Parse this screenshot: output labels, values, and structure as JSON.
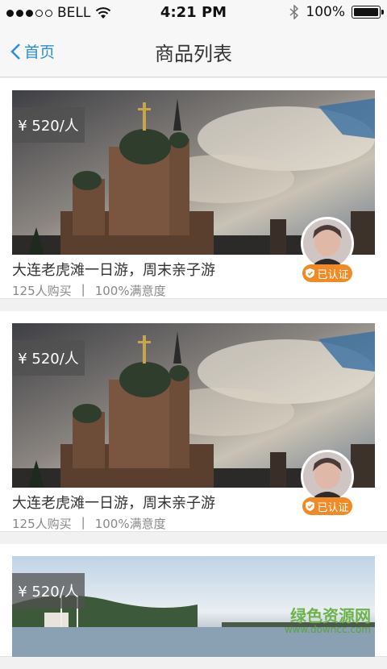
{
  "statusbar": {
    "carrier": "BELL",
    "time": "4:21 PM",
    "battery": "100%",
    "battery_level": 1.0
  },
  "nav": {
    "back_label": "首页",
    "title": "商品列表"
  },
  "products": [
    {
      "price": "¥ 520/人",
      "title": "大连老虎滩一日游，周末亲子游",
      "buyers": "125人购买",
      "satisfaction": "100%满意度",
      "badge": "已认证"
    },
    {
      "price": "¥ 520/人",
      "title": "大连老虎滩一日游，周末亲子游",
      "buyers": "125人购买",
      "satisfaction": "100%满意度",
      "badge": "已认证"
    },
    {
      "price": "¥ 520/人"
    }
  ],
  "watermark": {
    "text": "绿色资源网",
    "url": "www.downcc.com"
  },
  "colors": {
    "accent": "#2a8fd6",
    "badge": "#f08a24"
  }
}
